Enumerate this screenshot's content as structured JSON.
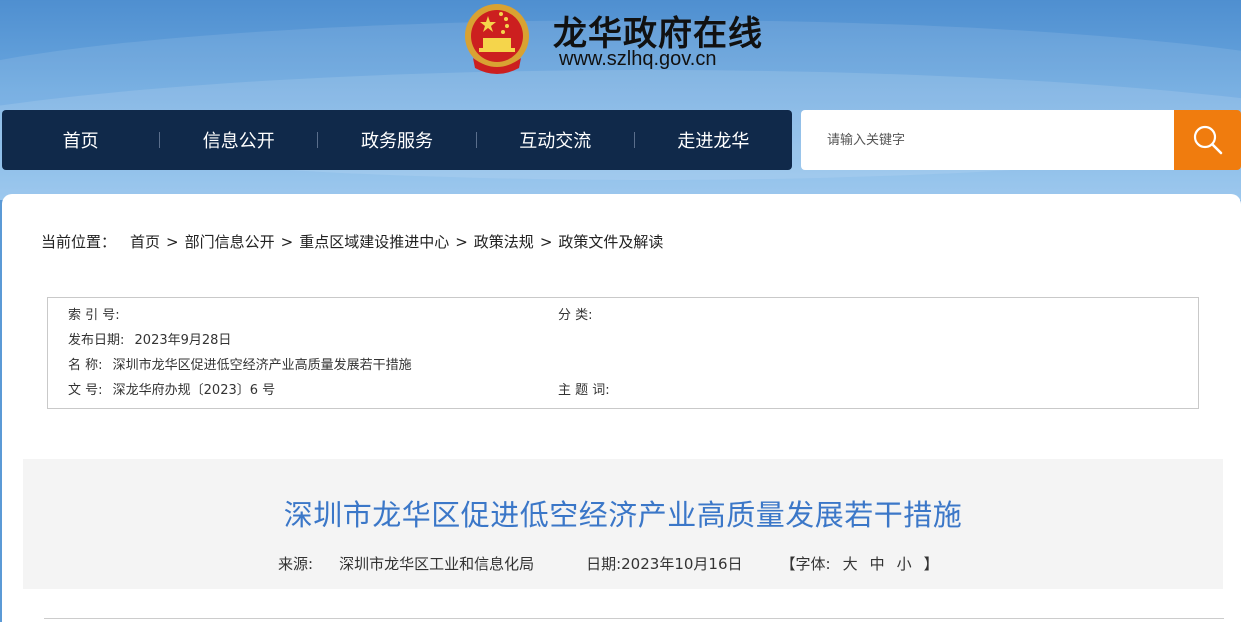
{
  "header": {
    "site_title": "龙华政府在线",
    "site_url": "www.szlhq.gov.cn"
  },
  "nav": {
    "items": [
      {
        "label": "首页"
      },
      {
        "label": "信息公开"
      },
      {
        "label": "政务服务"
      },
      {
        "label": "互动交流"
      },
      {
        "label": "走进龙华"
      }
    ]
  },
  "search": {
    "placeholder": "请输入关键字",
    "icon": "search-icon"
  },
  "breadcrumb": {
    "lead": "当前位置：",
    "items": [
      "首页",
      "部门信息公开",
      "重点区域建设推进中心",
      "政策法规",
      "政策文件及解读"
    ],
    "separator": ">"
  },
  "meta": {
    "index_label": "索 引 号:",
    "index_value": "",
    "category_label": "分 类:",
    "category_value": "",
    "date_label": "发布日期:",
    "date_value": "2023年9月28日",
    "name_label": "名 称:",
    "name_value": "深圳市龙华区促进低空经济产业高质量发展若干措施",
    "docno_label": "文 号:",
    "docno_value": "深龙华府办规〔2023〕6 号",
    "keywords_label": "主 题 词:",
    "keywords_value": ""
  },
  "document": {
    "title": "深圳市龙华区促进低空经济产业高质量发展若干措施",
    "source_label": "来源:",
    "source_value": "深圳市龙华区工业和信息化局",
    "date_label": "日期:",
    "date_value": "2023年10月16日",
    "font_label": "【字体:",
    "font_large": "大",
    "font_medium": "中",
    "font_small": "小",
    "font_close": "】"
  },
  "colors": {
    "nav_bg": "#10294a",
    "search_btn": "#f07c0e",
    "title": "#3b77c8"
  }
}
